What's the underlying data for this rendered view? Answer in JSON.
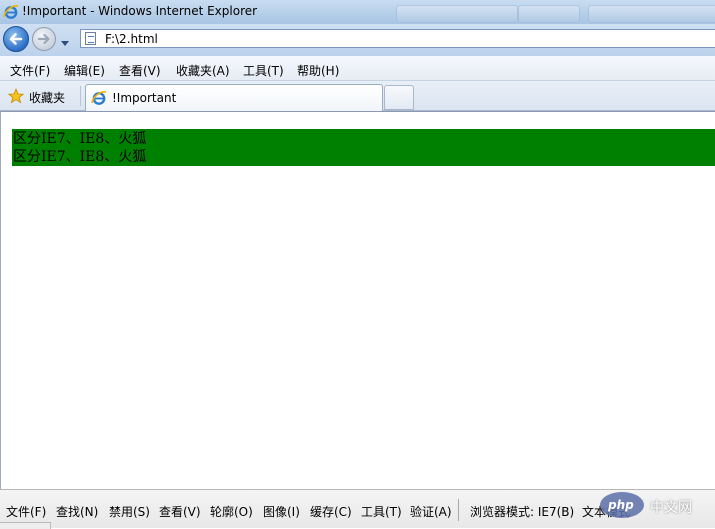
{
  "window": {
    "title": "!Important - Windows Internet Explorer"
  },
  "address_bar": {
    "url": "F:\\2.html"
  },
  "menu": {
    "items": [
      "文件(F)",
      "编辑(E)",
      "查看(V)",
      "收藏夹(A)",
      "工具(T)",
      "帮助(H)"
    ]
  },
  "favorites": {
    "label": "收藏夹"
  },
  "tabs": {
    "active_label": "!Important"
  },
  "content": {
    "lines": [
      "区分IE7、IE8、火狐",
      "区分IE7、IE8、火狐"
    ],
    "background_color": "#008000"
  },
  "dev_toolbar": {
    "items": [
      "文件(F)",
      "查找(N)",
      "禁用(S)",
      "查看(V)",
      "轮廓(O)",
      "图像(I)",
      "缓存(C)",
      "工具(T)",
      "验证(A)"
    ],
    "browser_mode": "浏览器模式: IE7(B)",
    "document_mode": "文本模式"
  },
  "watermark": {
    "brand": "php",
    "suffix": "中文网"
  },
  "icons": [
    "ie-logo-icon",
    "back-arrow-icon",
    "forward-arrow-icon",
    "dropdown-arrow-icon",
    "page-icon",
    "star-icon"
  ]
}
